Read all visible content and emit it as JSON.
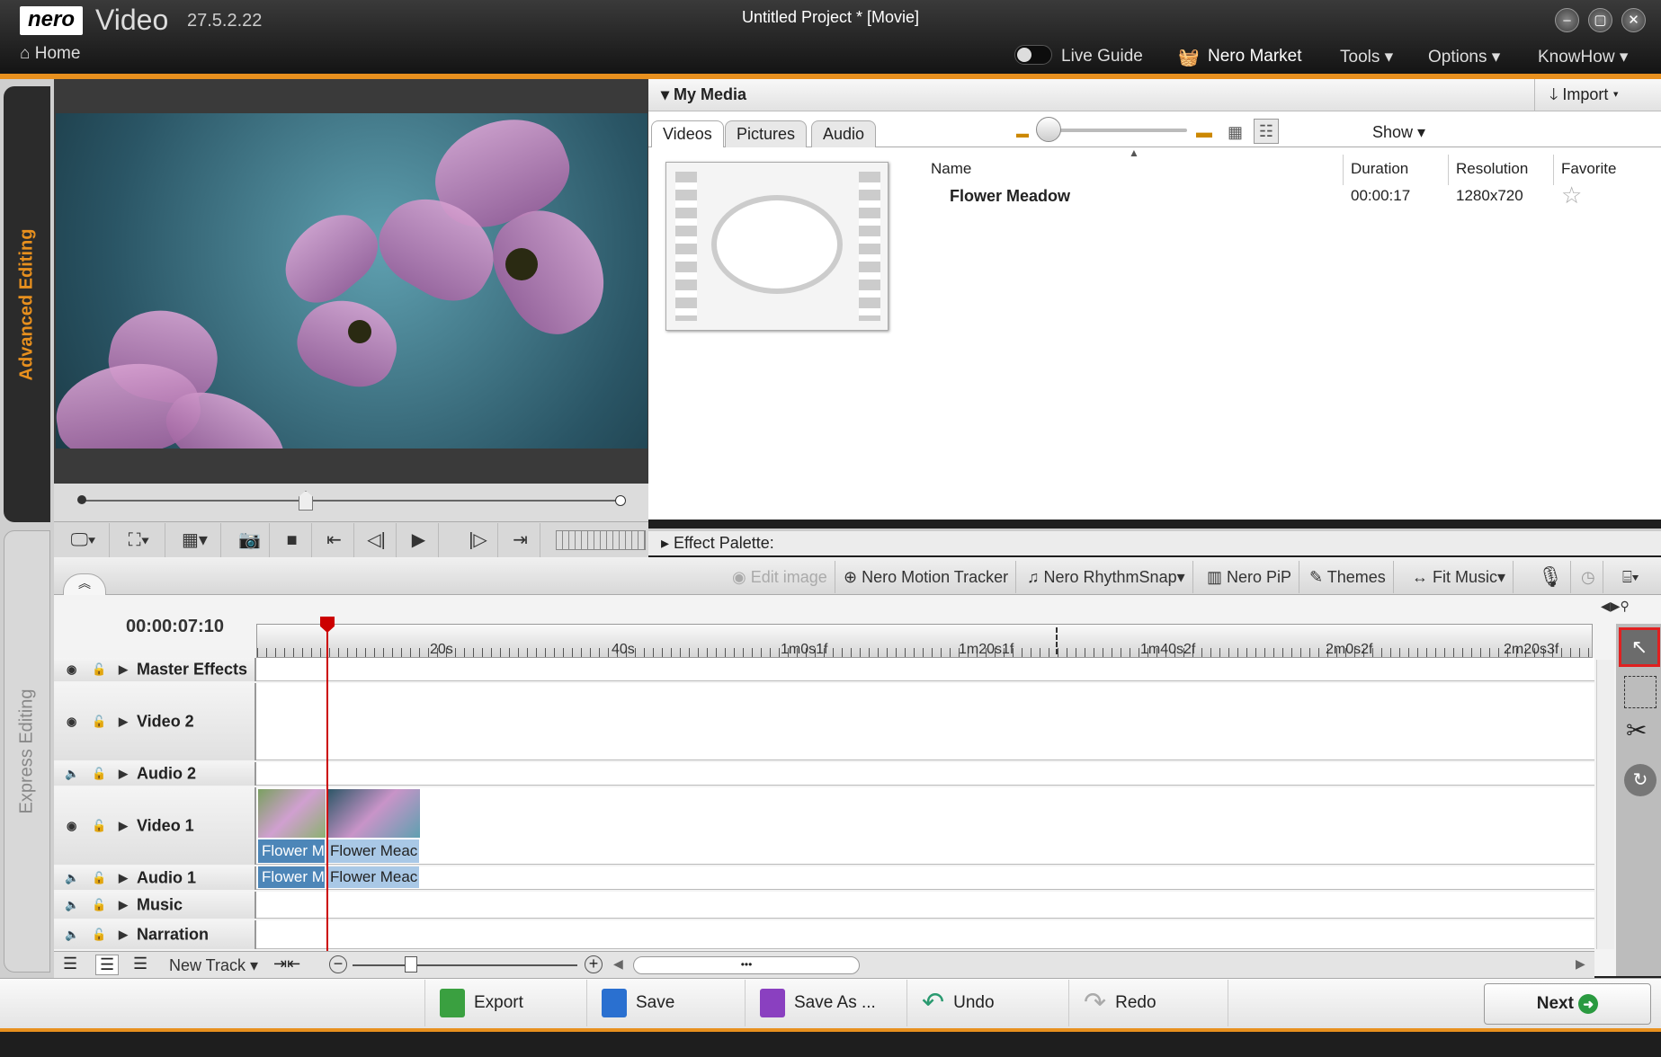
{
  "app": {
    "logo": "nero",
    "name": "Video",
    "version": "27.5.2.22",
    "title": "Untitled Project * [Movie]",
    "home": "Home"
  },
  "topmenu": {
    "live_guide": "Live Guide",
    "market": "Nero Market",
    "tools": "Tools ▾",
    "options": "Options ▾",
    "knowhow": "KnowHow ▾"
  },
  "window_buttons": {
    "minimize": "–",
    "restore": "▢",
    "close": "✕"
  },
  "side_tabs": {
    "advanced": "Advanced Editing",
    "express": "Express Editing"
  },
  "media": {
    "title": "My Media",
    "import": "Import ▾",
    "show": "Show ▾",
    "tabs": [
      "Videos",
      "Pictures",
      "Audio"
    ],
    "columns": {
      "name": "Name",
      "duration": "Duration",
      "resolution": "Resolution",
      "favorite": "Favorite"
    },
    "items": [
      {
        "name": "Flower Meadow",
        "duration": "00:00:17",
        "resolution": "1280x720"
      }
    ]
  },
  "effect_palette": "Effect Palette:",
  "toolbar": {
    "edit_image": "Edit image",
    "motion_tracker": "Nero Motion Tracker",
    "rhythmsnap": "Nero RhythmSnap▾",
    "pip": "Nero PiP",
    "themes": "Themes",
    "fit_music": "Fit Music▾"
  },
  "timeline": {
    "timecode": "00:00:07:10",
    "ruler": [
      "20s",
      "40s",
      "1m0s1f",
      "1m20s1f",
      "1m40s2f",
      "2m0s2f",
      "2m20s3f"
    ],
    "tracks": [
      "Master Effects",
      "Video 2",
      "Audio 2",
      "Video 1",
      "Audio 1",
      "Music",
      "Narration"
    ],
    "clips": {
      "a": "Flower M",
      "b": "Flower Meac"
    },
    "new_track": "New Track ▾"
  },
  "footer": {
    "export": "Export",
    "save": "Save",
    "save_as": "Save As ...",
    "undo": "Undo",
    "redo": "Redo",
    "next": "Next"
  },
  "colors": {
    "accent": "#e8901e",
    "clip": "#4d86b8",
    "playhead": "#cc0000",
    "selected_tool_border": "#e02020"
  }
}
